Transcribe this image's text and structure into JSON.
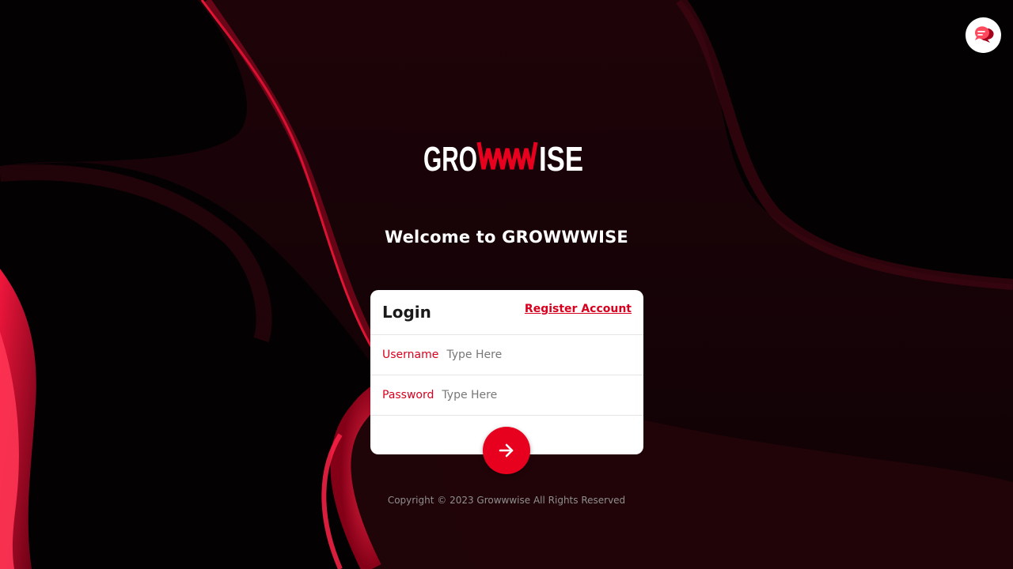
{
  "brand": {
    "logo_text": "GROWWWISE",
    "accent_color": "#e8001f"
  },
  "welcome": {
    "heading": "Welcome to GROWWWISE"
  },
  "login_card": {
    "title": "Login",
    "register_link": "Register Account",
    "username": {
      "label": "Username",
      "placeholder": "Type Here",
      "value": ""
    },
    "password": {
      "label": "Password",
      "placeholder": "Type Here",
      "value": ""
    },
    "submit_icon": "arrow-right-icon"
  },
  "footer": {
    "copyright": "Copyright © 2023 Growwwise All Rights Reserved"
  },
  "chat_widget": {
    "icon": "chat-bubbles-icon"
  }
}
